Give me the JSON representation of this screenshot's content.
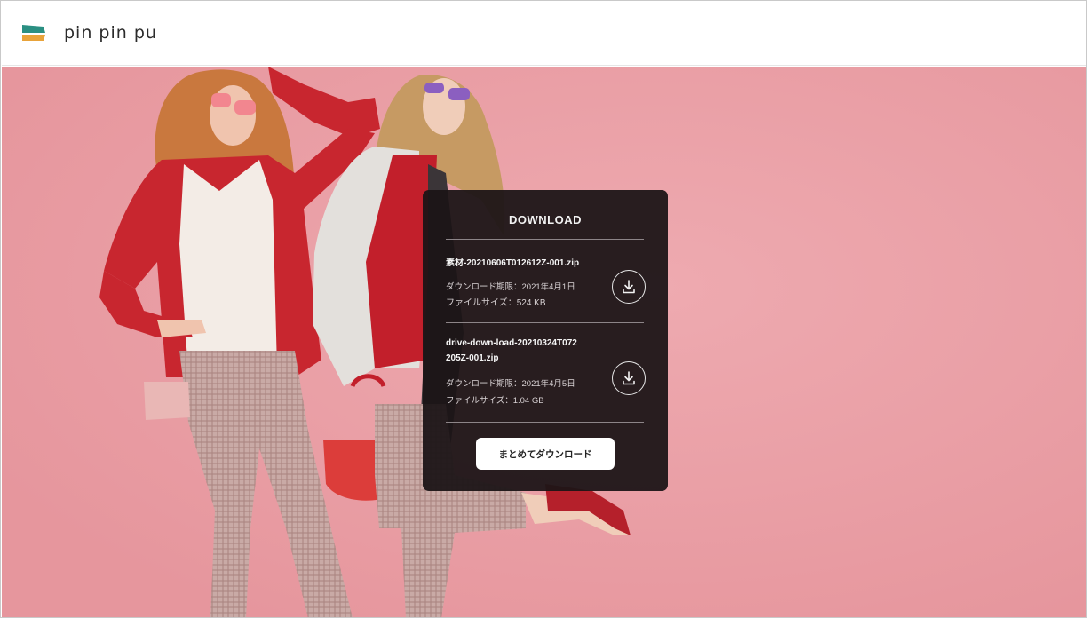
{
  "header": {
    "brand": "pin pin pu",
    "logo_colors": {
      "top": "#2a8f82",
      "bottom": "#e8a33a"
    }
  },
  "hero": {
    "background": "#e99ca2",
    "image": "two-models-fashion-photo"
  },
  "download_panel": {
    "title": "DOWNLOAD",
    "files": [
      {
        "name": "素材-20210606T012612Z-001.zip",
        "date_label": "ダウンロード期限：",
        "date_value": "2021年4月1日",
        "size_label": "ファイルサイズ：",
        "size_value": "524 KB",
        "icon": "download-icon"
      },
      {
        "name": "drive-down-load-20210324T072205Z-001.zip",
        "date_label": "ダウンロード期限：",
        "date_value": "2021年4月5日",
        "size_label": "ファイルサイズ：",
        "size_value": "1.04 GB",
        "icon": "download-icon"
      }
    ],
    "bulk_button_label": "まとめてダウンロード"
  }
}
